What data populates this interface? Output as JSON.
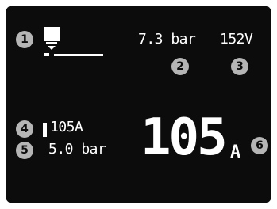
{
  "display": {
    "gas_pressure": "7.3 bar",
    "voltage": "152V",
    "current_setting": "105A",
    "air_pressure": "5.0 bar",
    "current_big_value": "105",
    "current_big_unit": "A"
  },
  "callouts": [
    "1",
    "2",
    "3",
    "4",
    "5",
    "6"
  ],
  "icons": {
    "torch": "plasma-torch-icon",
    "bar": "current-bar-icon"
  },
  "colors": {
    "screen_bg": "#0c0c0c",
    "text": "#ffffff",
    "badge": "#b5b5b5"
  }
}
